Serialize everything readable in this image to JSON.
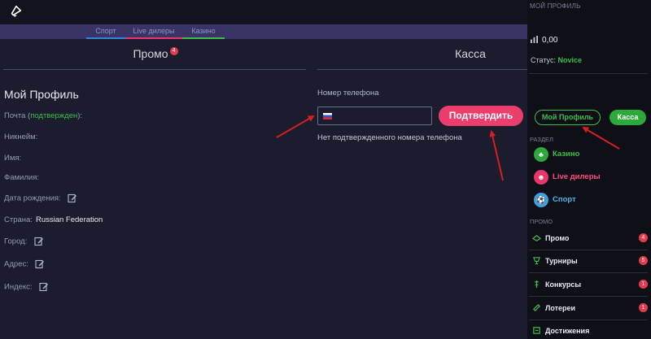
{
  "nav": {
    "tabs": [
      {
        "label": "Спорт",
        "color": "#2e86de"
      },
      {
        "label": "Live дилеры",
        "color": "#e8366b"
      },
      {
        "label": "Казино",
        "color": "#3fbf4a"
      }
    ]
  },
  "promo": {
    "title": "Промо",
    "badge": "4"
  },
  "cashier": {
    "title": "Касса",
    "phone_label": "Номер телефона",
    "phone_value": "",
    "confirm_button": "Подтвердить",
    "no_phone_text": "Нет подтвержденного номера телефона"
  },
  "profile": {
    "heading": "Мой Профиль",
    "email_label": "Почта (",
    "email_status": "подтвержден",
    "email_label_end": "):",
    "nickname_label": "Никнейм:",
    "name_label": "Имя:",
    "surname_label": "Фамилия:",
    "birthdate_label": "Дата рождения:",
    "country_label": "Страна:",
    "country_value": "Russian Federation",
    "city_label": "Город:",
    "address_label": "Адрес:",
    "index_label": "Индекс:"
  },
  "sidebar": {
    "title": "МОЙ ПРОФИЛЬ",
    "balance": "0,00",
    "status_label": "Статус: ",
    "status_value": "Novice",
    "profile_button": "Мой Профиль",
    "kassa_button": "Касса",
    "section_label": "РАЗДЕЛ",
    "categories": [
      {
        "label": "Казино",
        "color": "#3fbf4a",
        "icon": "casino-icon"
      },
      {
        "label": "Live дилеры",
        "color": "#e8366b",
        "icon": "live-dealer-icon"
      },
      {
        "label": "Спорт",
        "color": "#3aa0e0",
        "icon": "sport-icon"
      }
    ],
    "promo_label": "ПРОМО",
    "promo_items": [
      {
        "label": "Промо",
        "count": "4",
        "icon": "promo-icon"
      },
      {
        "label": "Турниры",
        "count": "5",
        "icon": "trophy-icon"
      },
      {
        "label": "Конкурсы",
        "count": "1",
        "icon": "contest-icon"
      },
      {
        "label": "Лотереи",
        "count": "1",
        "icon": "ticket-icon"
      },
      {
        "label": "Достижения",
        "count": "",
        "icon": "achievement-icon"
      }
    ]
  }
}
